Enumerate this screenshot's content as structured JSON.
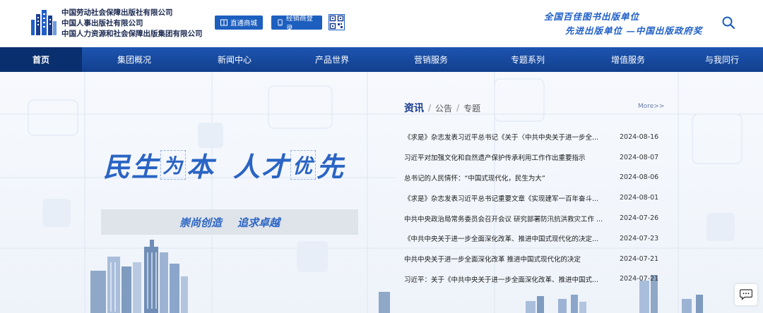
{
  "header": {
    "company_lines": [
      "中国劳动社会保障出版社有限公司",
      "中国人事出版社有限公司",
      "中国人力资源和社会保障出版集团有限公司"
    ],
    "mall_button": "直通商城",
    "dealer_button": "经销商登录",
    "slogan_line1": "全国百佳图书出版单位",
    "slogan_line2": "先进出版单位 —中国出版政府奖"
  },
  "nav": {
    "items": [
      {
        "label": "首页",
        "active": true
      },
      {
        "label": "集团概况",
        "active": false
      },
      {
        "label": "新闻中心",
        "active": false
      },
      {
        "label": "产品世界",
        "active": false
      },
      {
        "label": "营销服务",
        "active": false
      },
      {
        "label": "专题系列",
        "active": false
      },
      {
        "label": "增值服务",
        "active": false
      },
      {
        "label": "与我同行",
        "active": false
      }
    ]
  },
  "hero": {
    "t1": "民生",
    "t2": "为",
    "t3": "本",
    "t4": "人才",
    "t5": "优",
    "t6": "先",
    "sub1": "崇尚创造",
    "sub2": "追求卓越"
  },
  "news": {
    "tab_news": "资讯",
    "sep": "/",
    "tab_notice": "公告",
    "tab_topic": "专题",
    "more": "More>>",
    "items": [
      {
        "title": "《求是》杂志发表习近平总书记《关于〈中共中央关于进一步全...",
        "date": "2024-08-16"
      },
      {
        "title": "习近平对加强文化和自然遗产保护传承利用工作作出重要指示",
        "date": "2024-08-07"
      },
      {
        "title": "总书记的人民情怀：“中国式现代化，民生为大”",
        "date": "2024-08-06"
      },
      {
        "title": "《求是》杂志发表习近平总书记重要文章《实现建军一百年奋斗...",
        "date": "2024-08-01"
      },
      {
        "title": "中共中央政治局常务委员会召开会议 研究部署防汛抗洪救灾工作 ...",
        "date": "2024-07-26"
      },
      {
        "title": "《中共中央关于进一步全面深化改革、推进中国式现代化的决定...",
        "date": "2024-07-23"
      },
      {
        "title": "中共中央关于进一步全面深化改革 推进中国式现代化的决定",
        "date": "2024-07-21"
      },
      {
        "title": "习近平：关于《中共中央关于进一步全面深化改革、推进中国式...",
        "date": "2024-07-21"
      }
    ]
  },
  "colors": {
    "primary": "#1d5fbf",
    "nav_active": "#0a2f6e",
    "accent_text": "#2a64c4"
  }
}
